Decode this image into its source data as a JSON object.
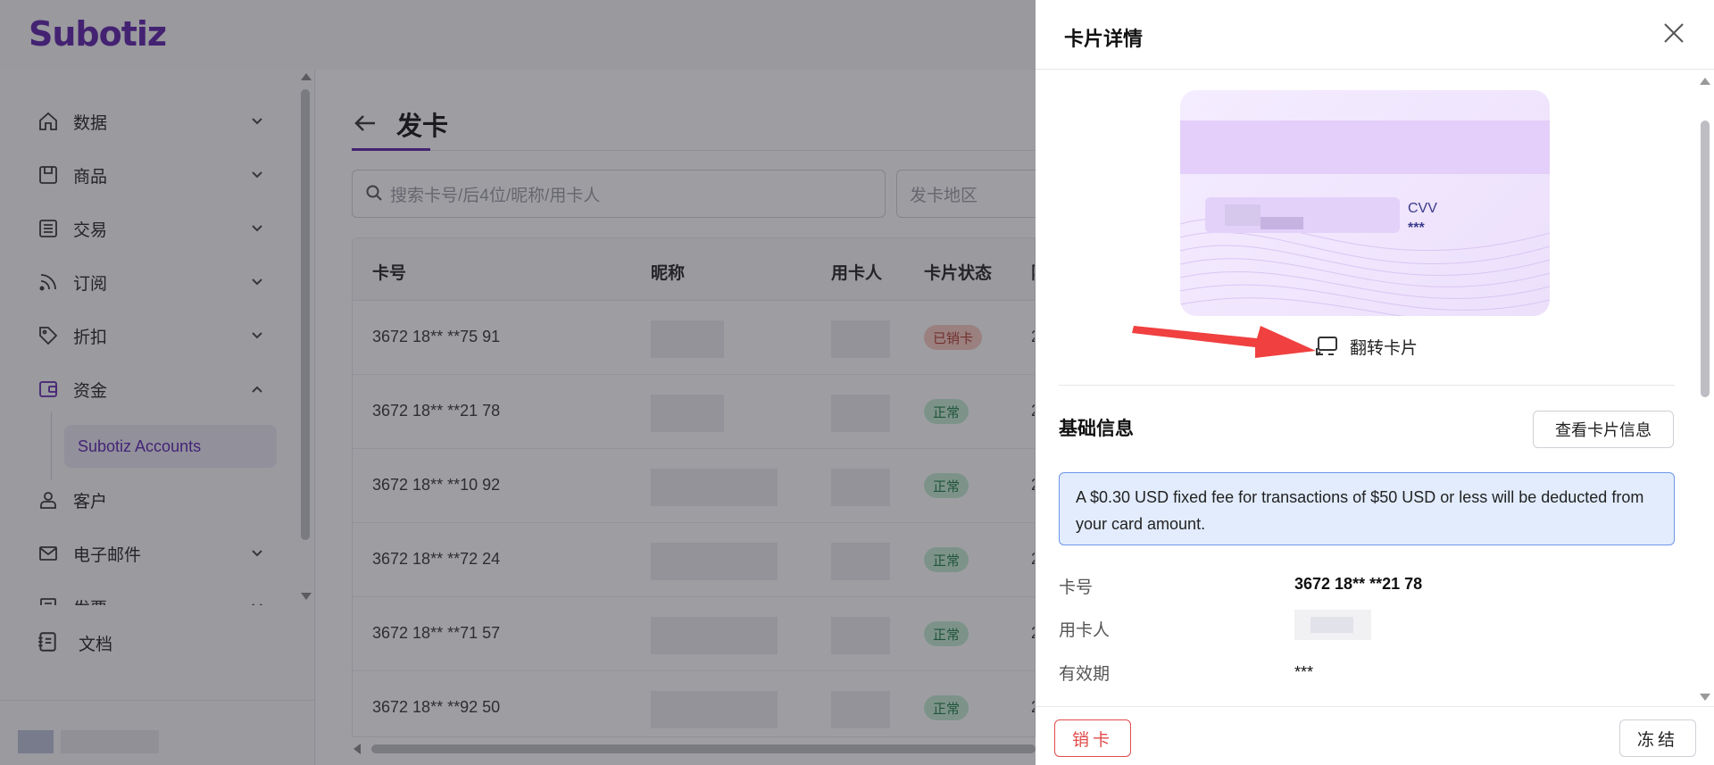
{
  "brand": {
    "logo": "Subotiz",
    "accent": "#5b1ea8"
  },
  "sidebar": {
    "items": [
      {
        "label": "数据",
        "icon": "home-icon",
        "expandable": true
      },
      {
        "label": "商品",
        "icon": "box-icon",
        "expandable": true
      },
      {
        "label": "交易",
        "icon": "list-icon",
        "expandable": true
      },
      {
        "label": "订阅",
        "icon": "rss-icon",
        "expandable": true
      },
      {
        "label": "折扣",
        "icon": "tag-icon",
        "expandable": true
      },
      {
        "label": "资金",
        "icon": "wallet-icon",
        "expandable": true,
        "expanded": true
      },
      {
        "label": "客户",
        "icon": "user-icon",
        "expandable": false
      },
      {
        "label": "电子邮件",
        "icon": "mail-icon",
        "expandable": true
      },
      {
        "label": "发票",
        "icon": "invoice-icon",
        "expandable": true
      }
    ],
    "sub_item": "Subotiz Accounts",
    "docs_label": "文档"
  },
  "main": {
    "title": "发卡",
    "search_placeholder": "搜索卡号/后4位/昵称/用卡人",
    "region_placeholder": "发卡地区",
    "columns": [
      "卡号",
      "昵称",
      "用卡人",
      "卡片状态",
      "限"
    ],
    "rows": [
      {
        "card_no": "3672 18** **75 91",
        "status": "已销卡",
        "status_type": "cancel",
        "tail": "2"
      },
      {
        "card_no": "3672 18** **21 78",
        "status": "正常",
        "status_type": "ok",
        "tail": "2"
      },
      {
        "card_no": "3672 18** **10 92",
        "status": "正常",
        "status_type": "ok",
        "tail": "2"
      },
      {
        "card_no": "3672 18** **72 24",
        "status": "正常",
        "status_type": "ok",
        "tail": "2"
      },
      {
        "card_no": "3672 18** **71 57",
        "status": "正常",
        "status_type": "ok",
        "tail": "2"
      },
      {
        "card_no": "3672 18** **92 50",
        "status": "正常",
        "status_type": "ok",
        "tail": "2"
      }
    ]
  },
  "drawer": {
    "title": "卡片详情",
    "card": {
      "cvv_label": "CVV",
      "cvv_value": "***"
    },
    "flip_label": "翻转卡片",
    "section_title": "基础信息",
    "view_button": "查看卡片信息",
    "notice": "A $0.30 USD fixed fee for transactions of $50 USD or less will be deducted from your card amount.",
    "fields": [
      {
        "label": "卡号",
        "value": "3672 18** **21 78"
      },
      {
        "label": "用卡人",
        "value": ""
      },
      {
        "label": "有效期",
        "value": "***"
      }
    ],
    "cancel_button": "销卡",
    "freeze_button": "冻结"
  }
}
